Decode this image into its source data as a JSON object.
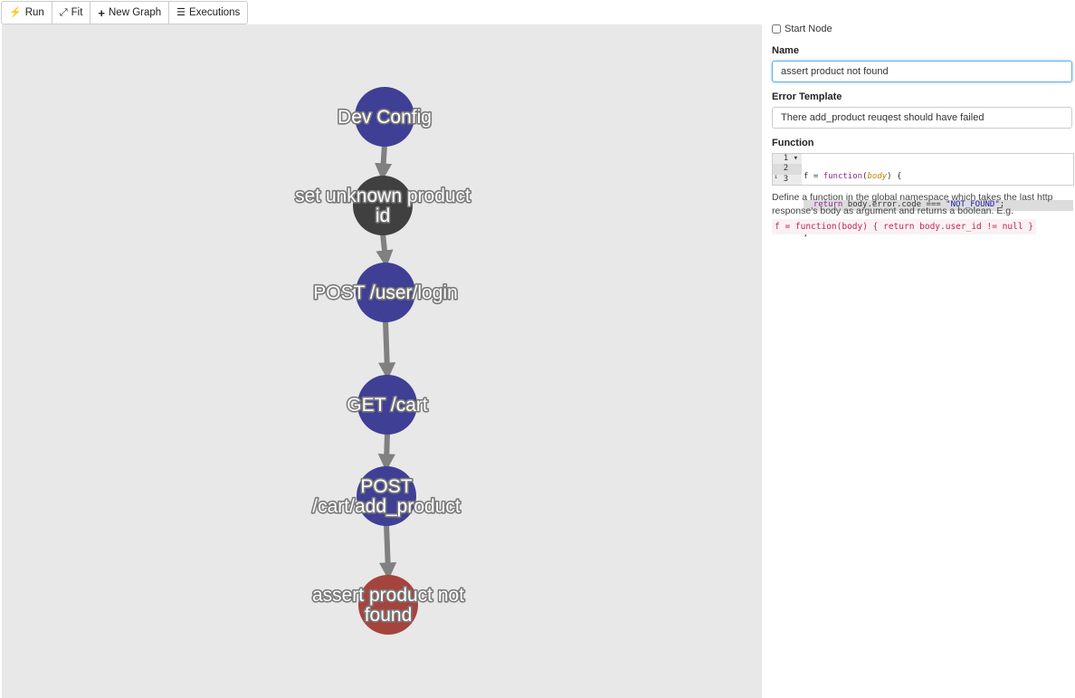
{
  "toolbar": {
    "run_label": "Run",
    "fit_label": "Fit",
    "new_graph_label": "New Graph",
    "executions_label": "Executions"
  },
  "graph": {
    "colors": {
      "request": "#3f3f95",
      "transform": "#404040",
      "assertion": "#a4443d",
      "edge": "#808080"
    },
    "nodes": [
      {
        "id": "dev-config",
        "label": [
          "Dev Config"
        ],
        "kind": "request"
      },
      {
        "id": "set-unknown-product-id",
        "label": [
          "set unknown product",
          "id"
        ],
        "kind": "transform"
      },
      {
        "id": "post-user-login",
        "label": [
          "POST /user/login"
        ],
        "kind": "request"
      },
      {
        "id": "get-cart",
        "label": [
          "GET /cart"
        ],
        "kind": "request"
      },
      {
        "id": "post-cart-add-product",
        "label": [
          "POST",
          "/cart/add_product"
        ],
        "kind": "request"
      },
      {
        "id": "assert-product-not-found",
        "label": [
          "assert product not",
          "found"
        ],
        "kind": "assertion"
      }
    ]
  },
  "panel": {
    "start_node_label": "Start Node",
    "start_node_checked": false,
    "name_label": "Name",
    "name_value": "assert product not found",
    "error_template_label": "Error Template",
    "error_template_value": "There add_product reuqest should have failed",
    "function_label": "Function",
    "code_line_numbers": [
      "1",
      "2",
      "3"
    ],
    "help_text": "Define a function in the global namespace which takes the last http response's body as argument and returns a boolean. E.g.",
    "help_example": "f = function(body) { return body.user_id != null }"
  }
}
